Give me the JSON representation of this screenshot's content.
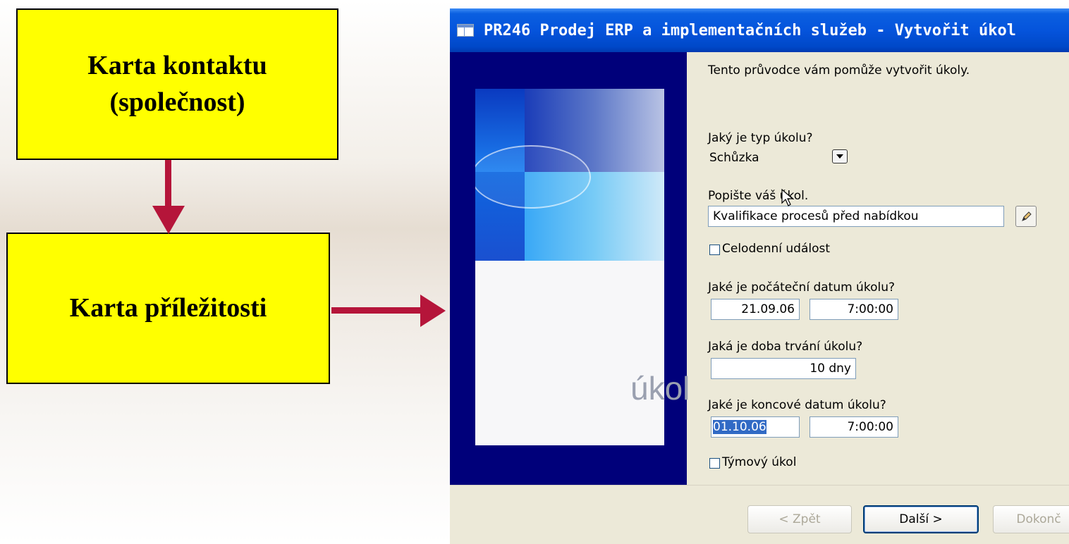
{
  "slide": {
    "box_contact": "Karta kontaktu (společnost)",
    "box_opportunity": "Karta příležitosti"
  },
  "window": {
    "title": "PR246 Prodej ERP a implementačních služeb - Vytvořit úkol"
  },
  "wizard": {
    "intro": "Tento průvodce vám pomůže vytvořit úkoly.",
    "watermark": "úkol",
    "type_label": "Jaký je typ úkolu?",
    "type_value": "Schůzka",
    "describe_label": "Popište váš úkol.",
    "describe_value": "Kvalifikace procesů před nabídkou",
    "allday_label": "Celodenní událost",
    "start_label": "Jaké je počáteční datum úkolu?",
    "start_date": "21.09.06",
    "start_time": "7:00:00",
    "duration_label": "Jaká je doba trvání úkolu?",
    "duration_value": "10 dny",
    "end_label": "Jaké je koncové datum úkolu?",
    "end_date": "01.10.06",
    "end_time": "7:00:00",
    "team_label": "Týmový úkol"
  },
  "buttons": {
    "back": "< Zpět",
    "next": "Další >",
    "finish": "Dokonč"
  },
  "colors": {
    "slide_box": "#ffff00",
    "arrow": "#b5153a",
    "titlebar": "#0554dc",
    "sidebar": "#00007a"
  }
}
